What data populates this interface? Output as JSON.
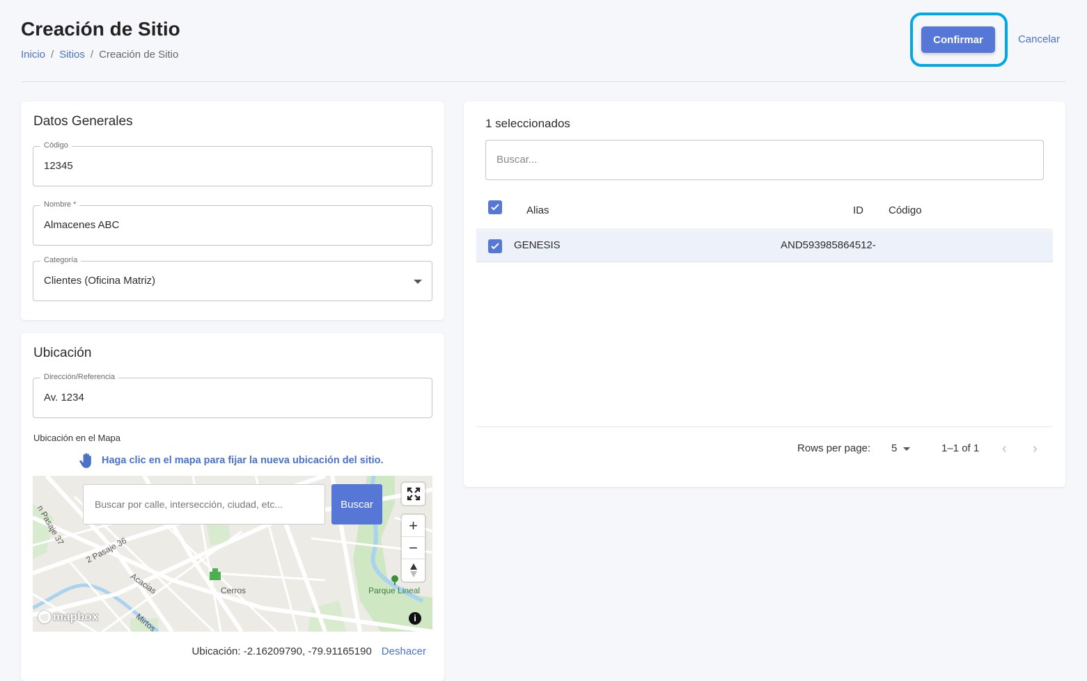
{
  "header": {
    "title": "Creación de Sitio",
    "breadcrumb": [
      "Inicio",
      "Sitios",
      "Creación de Sitio"
    ],
    "confirm_label": "Confirmar",
    "cancel_label": "Cancelar",
    "accent_color": "#5677d6",
    "highlight_color": "#00a8e8"
  },
  "general": {
    "title": "Datos Generales",
    "codigo_label": "Código",
    "codigo_value": "12345",
    "nombre_label": "Nombre *",
    "nombre_value": "Almacenes ABC",
    "categoria_label": "Categoría",
    "categoria_value": "Clientes (Oficina Matriz)"
  },
  "location": {
    "title": "Ubicación",
    "direccion_label": "Dirección/Referencia",
    "direccion_value": "Av. 1234",
    "map_label": "Ubicación en el Mapa",
    "map_hint": "Haga clic en el mapa para fijar la nueva ubicación del sitio.",
    "map_search_placeholder": "Buscar por calle, intersección, ciudad, etc...",
    "map_search_button": "Buscar",
    "map_labels": [
      "2 Pasaje 36",
      "Acacias",
      "Cerros",
      "Parque Lineal",
      "Mirtos",
      "n Pasaje 37"
    ],
    "mapbox_logo": "mapbox",
    "coords_text": "Ubicación: -2.16209790, -79.91165190",
    "undo_label": "Deshacer"
  },
  "sites": {
    "selected_count": "1 seleccionados",
    "search_placeholder": "Buscar...",
    "columns": {
      "alias": "Alias",
      "id": "ID",
      "codigo": "Código"
    },
    "rows": [
      {
        "alias": "GENESIS",
        "id": "AND593985864512-",
        "codigo": ""
      }
    ],
    "rows_per_page_label": "Rows per page:",
    "rows_per_page_value": "5",
    "range_text": "1–1 of 1"
  }
}
